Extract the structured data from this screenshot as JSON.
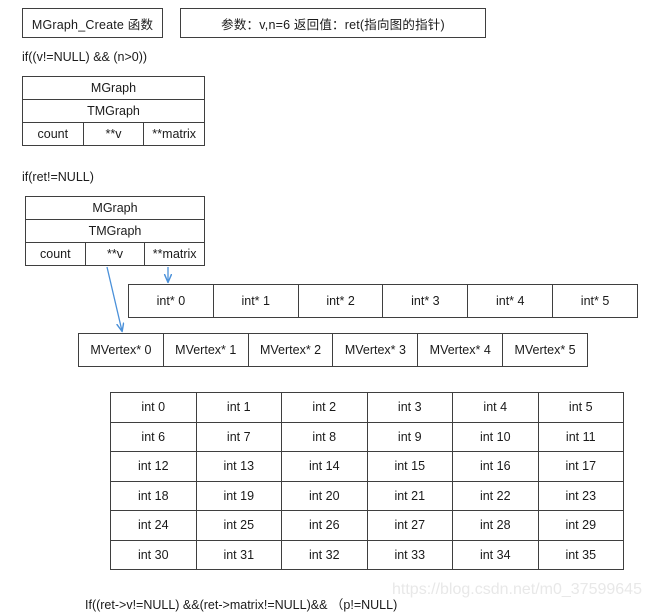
{
  "header": {
    "function_box": "MGraph_Create 函数",
    "params_box": "参数：v,n=6   返回值：ret(指向图的指针)"
  },
  "conditions": {
    "first": "if((v!=NULL) && (n>0))",
    "second": "if(ret!=NULL)",
    "bottom": "If((ret->v!=NULL) &&(ret->matrix!=NULL)&& （p!=NULL)"
  },
  "struct1": {
    "title": "MGraph",
    "subtitle": "TMGraph",
    "fields": [
      "count",
      "**v",
      "**matrix"
    ]
  },
  "struct2": {
    "title": "MGraph",
    "subtitle": "TMGraph",
    "fields": [
      "count",
      "**v",
      "**matrix"
    ]
  },
  "matrix_pointer_row": {
    "cells": [
      "int* 0",
      "int* 1",
      "int* 2",
      "int* 3",
      "int* 4",
      "int* 5"
    ]
  },
  "vertex_pointer_row": {
    "cells": [
      "MVertex* 0",
      "MVertex* 1",
      "MVertex* 2",
      "MVertex* 3",
      "MVertex* 4",
      "MVertex* 5"
    ]
  },
  "matrix_grid": {
    "rows": [
      [
        "int 0",
        "int 1",
        "int 2",
        "int 3",
        "int 4",
        "int 5"
      ],
      [
        "int 6",
        "int 7",
        "int 8",
        "int 9",
        "int 10",
        "int 11"
      ],
      [
        "int 12",
        "int 13",
        "int 14",
        "int 15",
        "int 16",
        "int 17"
      ],
      [
        "int 18",
        "int 19",
        "int 20",
        "int 21",
        "int 22",
        "int 23"
      ],
      [
        "int 24",
        "int 25",
        "int 26",
        "int 27",
        "int 28",
        "int 29"
      ],
      [
        "int 30",
        "int 31",
        "int 32",
        "int 33",
        "int 34",
        "int 35"
      ]
    ]
  },
  "watermark": {
    "text": "https://blog.csdn.net/m0_37599645"
  },
  "colors": {
    "arrow": "#4a90d9",
    "border": "#3f3f3f",
    "text": "#1a1a1a",
    "watermark": "#e8e8e8"
  }
}
